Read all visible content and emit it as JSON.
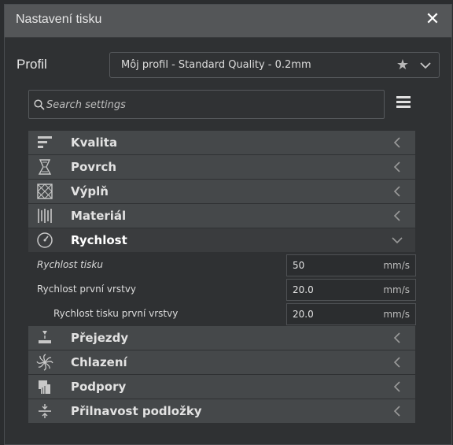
{
  "window": {
    "title": "Nastavení tisku",
    "close_glyph": "✕"
  },
  "profile": {
    "label": "Profil",
    "value": "Môj profil - Standard Quality - 0.2mm",
    "star_glyph": "★"
  },
  "search": {
    "placeholder": "Search settings"
  },
  "categories_top": [
    {
      "label": "Kvalita",
      "icon": "quality-icon"
    },
    {
      "label": "Povrch",
      "icon": "shell-icon"
    },
    {
      "label": "Výplň",
      "icon": "infill-icon"
    },
    {
      "label": "Materiál",
      "icon": "material-icon"
    }
  ],
  "speed": {
    "label": "Rychlost",
    "icon": "speedometer-icon",
    "settings": [
      {
        "label": "Rychlost tisku",
        "value": "50",
        "unit": "mm/s"
      },
      {
        "label": "Rychlost první vrstvy",
        "value": "20.0",
        "unit": "mm/s"
      },
      {
        "label": "Rychlost tisku první vrstvy",
        "value": "20.0",
        "unit": "mm/s"
      }
    ]
  },
  "categories_bottom": [
    {
      "label": "Přejezdy",
      "icon": "travel-icon"
    },
    {
      "label": "Chlazení",
      "icon": "cooling-fan-icon"
    },
    {
      "label": "Podpory",
      "icon": "support-icon"
    },
    {
      "label": "Přilnavost podložky",
      "icon": "adhesion-icon"
    }
  ],
  "colors": {
    "titlebar": "#545658",
    "panel": "#2f3133",
    "category": "#45484a"
  }
}
